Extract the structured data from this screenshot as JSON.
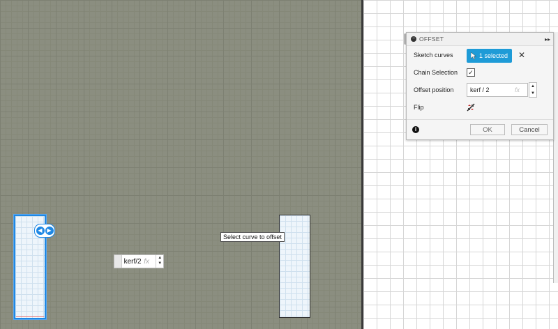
{
  "canvas": {
    "tooltip_text": "Select curve to offset",
    "inline_input": {
      "value": "kerf/2",
      "fx_label": "fx"
    },
    "flip_handle_icon": "flip-arrows-icon"
  },
  "dialog": {
    "title": "OFFSET",
    "rows": {
      "sketch_curves": {
        "label": "Sketch curves",
        "selection_label": "1 selected",
        "clear_label": "✕"
      },
      "chain_selection": {
        "label": "Chain Selection",
        "checked": true,
        "check_glyph": "✓"
      },
      "offset_position": {
        "label": "Offset position",
        "value": "kerf / 2",
        "fx_label": "fx"
      },
      "flip": {
        "label": "Flip"
      }
    },
    "footer": {
      "ok_label": "OK",
      "cancel_label": "Cancel",
      "info_glyph": "i"
    }
  },
  "colors": {
    "accent": "#1e9bd7",
    "selection_blue": "#1e88e5",
    "canvas_gray": "#8b8e80"
  }
}
